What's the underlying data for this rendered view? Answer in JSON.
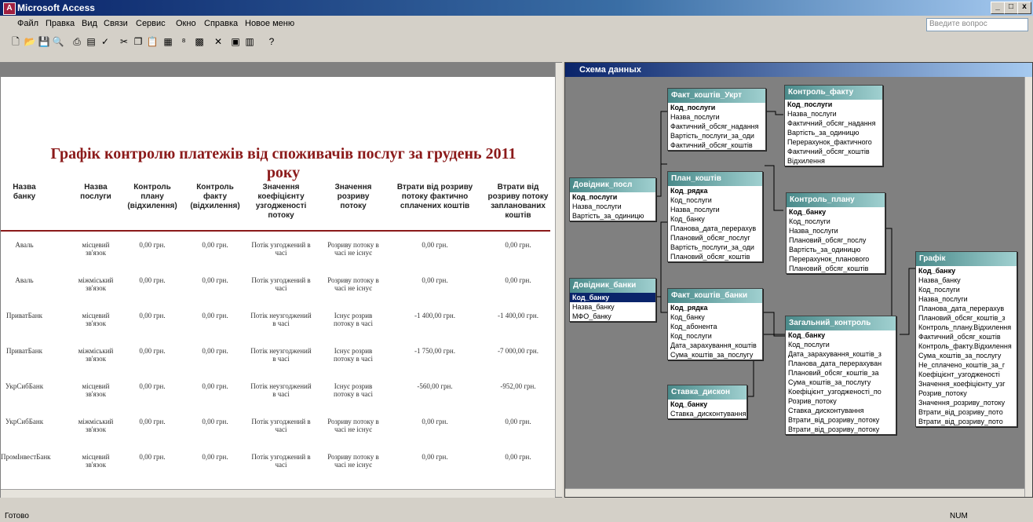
{
  "window": {
    "title": "Microsoft Access",
    "min": "_",
    "max": "□",
    "close": "x"
  },
  "menu": [
    "Файл",
    "Правка",
    "Вид",
    "Связи",
    "Сервис",
    "Окно",
    "Справка",
    "Новое меню"
  ],
  "ask_placeholder": "Введите вопрос",
  "report": {
    "title": "Графік контролю платежів від споживачів послуг за грудень 2011 року",
    "headers": [
      "Назва банку",
      "Назва послуги",
      "Контроль плану (відхилення)",
      "Контроль факту (відхилення)",
      "Значення коефіцієнту узгодженості потоку",
      "Значення розриву потоку",
      "Втрати від розриву потоку фактично сплачених коштів",
      "Втрати від розриву потоку запланованих коштів"
    ],
    "rows": [
      [
        "Аваль",
        "місцевий зв'язок",
        "0,00 грн.",
        "0,00 грн.",
        "Потік узгоджений в часі",
        "Розриву потоку в часі не існує",
        "0,00 грн.",
        "0,00 грн."
      ],
      [
        "Аваль",
        "міжміський зв'язок",
        "0,00 грн.",
        "0,00 грн.",
        "Потік узгоджений в часі",
        "Розриву потоку в часі не існує",
        "0,00 грн.",
        "0,00 грн."
      ],
      [
        "ПриватБанк",
        "місцевий зв'язок",
        "0,00 грн.",
        "0,00 грн.",
        "Потік неузгоджений в часі",
        "Існує розрив потоку в часі",
        "-1 400,00 грн.",
        "-1 400,00 грн."
      ],
      [
        "ПриватБанк",
        "міжміський зв'язок",
        "0,00 грн.",
        "0,00 грн.",
        "Потік неузгоджений в часі",
        "Існує розрив потоку в часі",
        "-1 750,00 грн.",
        "-7 000,00 грн."
      ],
      [
        "УкрСибБанк",
        "місцевий зв'язок",
        "0,00 грн.",
        "0,00 грн.",
        "Потік неузгоджений в часі",
        "Існує розрив потоку в часі",
        "-560,00 грн.",
        "-952,00 грн."
      ],
      [
        "УкрСибБанк",
        "міжміський зв'язок",
        "0,00 грн.",
        "0,00 грн.",
        "Потік узгоджений в часі",
        "Розриву потоку в часі не існує",
        "0,00 грн.",
        "0,00 грн."
      ],
      [
        "ПромІнвестБанк",
        "місцевий зв'язок",
        "0,00 грн.",
        "0,00 грн.",
        "Потік узгоджений в часі",
        "Розриву потоку в часі не існує",
        "0,00 грн.",
        "0,00 грн."
      ]
    ]
  },
  "schema": {
    "title": "Схема данных",
    "tables": [
      {
        "name": "Факт_коштів_Укрт",
        "fields": [
          "Код_послуги",
          "Назва_послуги",
          "Фактичний_обсяг_надання",
          "Вартість_послуги_за_оди",
          "Фактичний_обсяг_коштів"
        ]
      },
      {
        "name": "Контроль_факту",
        "fields": [
          "Код_послуги",
          "Назва_послуги",
          "Фактичний_обсяг_надання",
          "Вартість_за_одиницю",
          "Перерахунок_фактичного",
          "Фактичний_обсяг_коштів",
          "Відхилення"
        ]
      },
      {
        "name": "Довідник_посл",
        "fields": [
          "Код_послуги",
          "Назва_послуги",
          "Вартість_за_одиницю"
        ]
      },
      {
        "name": "План_коштів",
        "fields": [
          "Код_рядка",
          "Код_послуги",
          "Назва_послуги",
          "Код_банку",
          "Планова_дата_перерахув",
          "Плановий_обсяг_послуг",
          "Вартість_послуги_за_оди",
          "Плановий_обсяг_коштів"
        ]
      },
      {
        "name": "Контроль_плану",
        "fields": [
          "Код_банку",
          "Код_послуги",
          "Назва_послуги",
          "Плановий_обсяг_послу",
          "Вартість_за_одиницю",
          "Перерахунок_планового",
          "Плановий_обсяг_коштів"
        ]
      },
      {
        "name": "Графік",
        "fields": [
          "Код_банку",
          "Назва_банку",
          "Код_послуги",
          "Назва_послуги",
          "Планова_дата_перерахув",
          "Плановий_обсяг_коштів_з",
          "Контроль_плану.Відхилення",
          "Фактичний_обсяг_коштів",
          "Контроль_факту.Відхилення",
          "Сума_коштів_за_послугу",
          "Не_сплачено_коштів_за_г",
          "Коефіцієнт_узгодженості",
          "Значення_коефіцієнту_узг",
          "Розрив_потоку",
          "Значення_розриву_потоку",
          "Втрати_від_розриву_пото",
          "Втрати_від_розриву_пото"
        ]
      },
      {
        "name": "Довідник_банки",
        "fields": [
          "Код_банку",
          "Назва_банку",
          "МФО_банку"
        ]
      },
      {
        "name": "Факт_коштів_банки",
        "fields": [
          "Код_рядка",
          "Код_банку",
          "Код_абонента",
          "Код_послуги",
          "Дата_зарахування_коштів",
          "Сума_коштів_за_послугу"
        ]
      },
      {
        "name": "Загальний_контроль",
        "fields": [
          "Код_банку",
          "Код_послуги",
          "Дата_зарахування_коштів_з",
          "Планова_дата_перерахуван",
          "Плановий_обсяг_коштів_за",
          "Сума_коштів_за_послугу",
          "Коефіцієнт_узгодженості_по",
          "Розрив_потоку",
          "Ставка_дисконтування",
          "Втрати_від_розриву_потоку",
          "Втрати_від_розриву_потоку"
        ]
      },
      {
        "name": "Ставка_дискон",
        "fields": [
          "Код_банку",
          "Ставка_дисконтування"
        ]
      }
    ]
  },
  "status": {
    "text": "Готово",
    "num": "NUM"
  }
}
